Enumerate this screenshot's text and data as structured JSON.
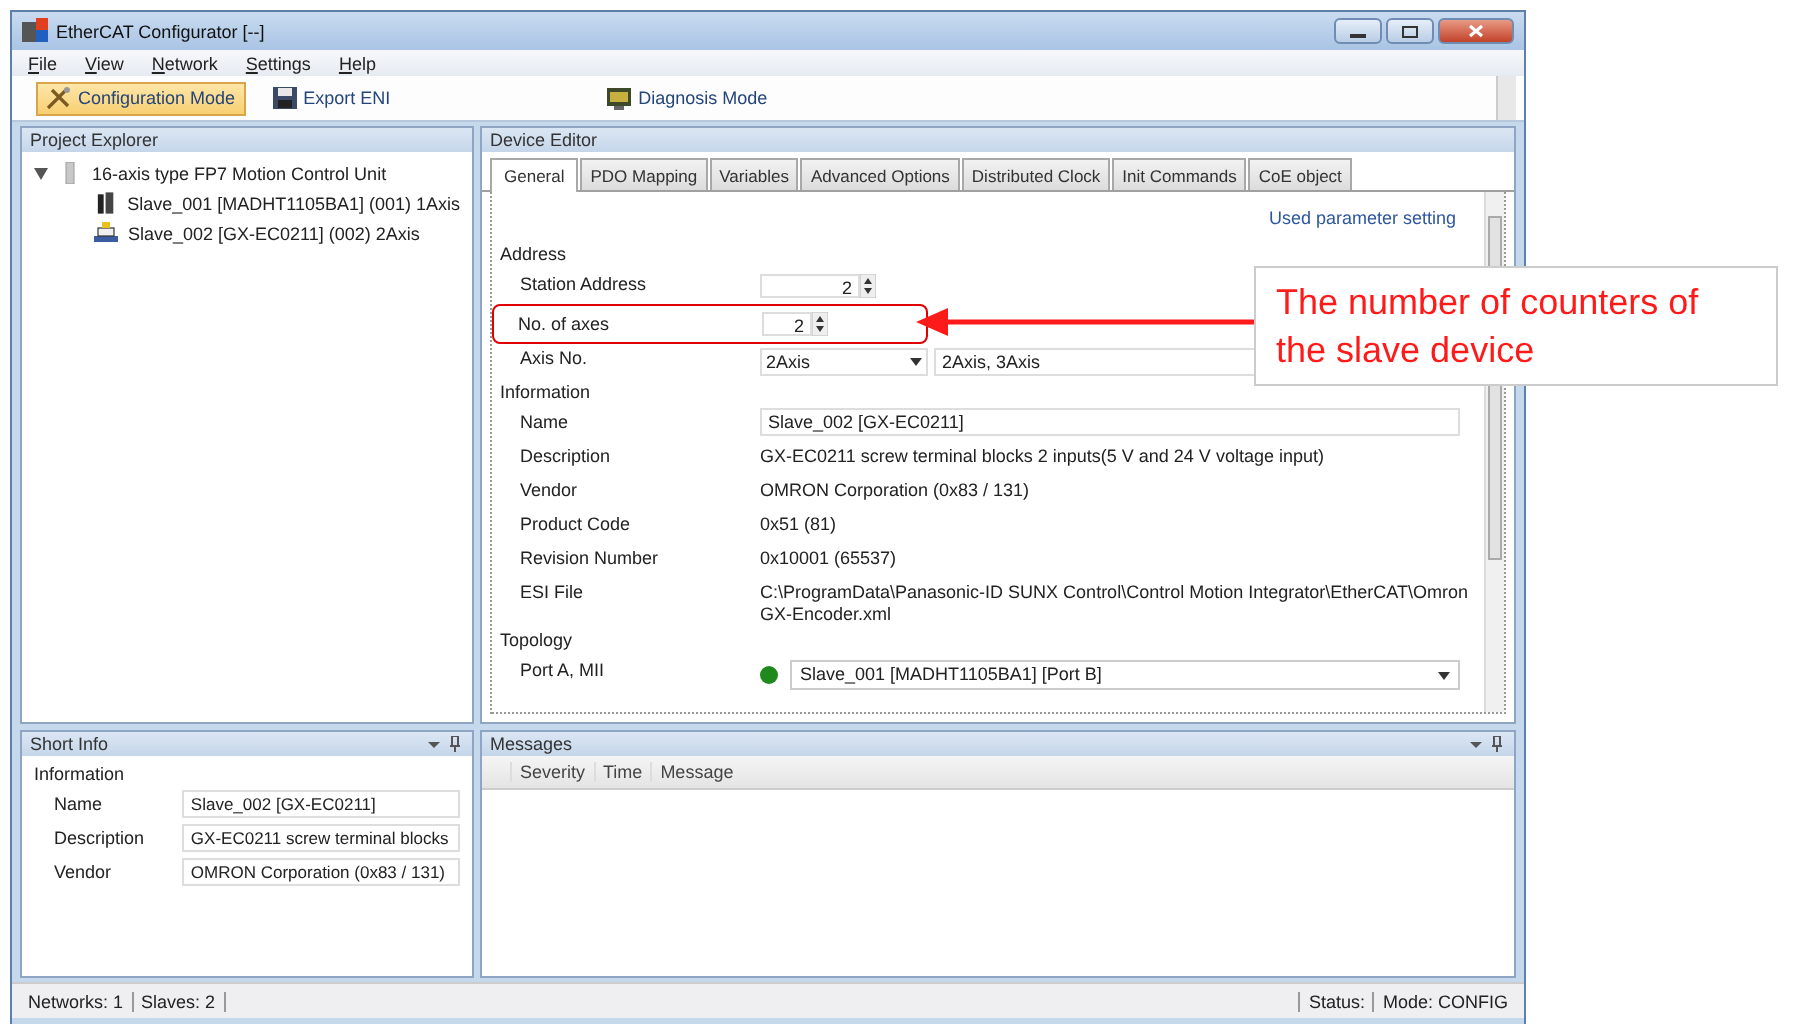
{
  "window": {
    "title": "EtherCAT Configurator [--]"
  },
  "menu": [
    "File",
    "View",
    "Network",
    "Settings",
    "Help"
  ],
  "toolbar": [
    {
      "label": "Configuration Mode",
      "kind": "tools",
      "selected": true
    },
    {
      "label": "Export ENI",
      "kind": "disk",
      "selected": false
    },
    {
      "label": "Diagnosis Mode",
      "kind": "monitor",
      "selected": false
    }
  ],
  "project_explorer": {
    "title": "Project Explorer",
    "tree": [
      {
        "label": "16-axis type FP7 Motion Control Unit",
        "kind": "unit",
        "expanded": true,
        "children": [
          {
            "label": "Slave_001 [MADHT1105BA1] (001) 1Axis",
            "kind": "servo"
          },
          {
            "label": "Slave_002 [GX-EC0211] (002) 2Axis",
            "kind": "encoder"
          }
        ]
      }
    ]
  },
  "device_editor": {
    "title": "Device Editor",
    "tabs": [
      {
        "label": "General",
        "selected": true
      },
      {
        "label": "PDO Mapping",
        "selected": false
      },
      {
        "label": "Variables",
        "selected": false
      },
      {
        "label": "Advanced Options",
        "selected": false
      },
      {
        "label": "Distributed Clock",
        "selected": false
      },
      {
        "label": "Init Commands",
        "selected": false
      },
      {
        "label": "CoE object",
        "selected": false
      }
    ],
    "link": "Used parameter setting",
    "sections": [
      {
        "title": "Address",
        "rows": [
          {
            "label": "Station Address",
            "kind": "spinner",
            "value": "2",
            "highlighted": false
          },
          {
            "label": "No. of axes",
            "kind": "spinner",
            "value": "2",
            "highlighted": true
          },
          {
            "label": "Axis No.",
            "kind": "dropdown",
            "value": "2Axis",
            "extra": "2Axis, 3Axis"
          }
        ]
      },
      {
        "title": "Information",
        "rows": [
          {
            "label": "Name",
            "kind": "field",
            "value": "Slave_002 [GX-EC0211]"
          },
          {
            "label": "Description",
            "kind": "text",
            "value": "GX-EC0211 screw terminal blocks 2 inputs(5 V and 24 V voltage input)"
          },
          {
            "label": "Vendor",
            "kind": "text",
            "value": "OMRON Corporation (0x83 / 131)"
          },
          {
            "label": "Product Code",
            "kind": "text",
            "value": "0x51 (81)"
          },
          {
            "label": "Revision Number",
            "kind": "text",
            "value": "0x10001 (65537)"
          },
          {
            "label": "ESI File",
            "kind": "text",
            "value": "C:\\ProgramData\\Panasonic-ID SUNX Control\\Control Motion Integrator\\EtherCAT\\Omron GX-Encoder.xml"
          }
        ]
      },
      {
        "title": "Topology",
        "rows": [
          {
            "label": "Port A, MII",
            "kind": "port",
            "value": "Slave_001 [MADHT1105BA1] [Port B]",
            "color": "#1e8a1e"
          }
        ]
      }
    ]
  },
  "short_info": {
    "title": "Short Info",
    "section": "Information",
    "rows": [
      {
        "label": "Name",
        "value": "Slave_002 [GX-EC0211]"
      },
      {
        "label": "Description",
        "value": "GX-EC0211 screw terminal blocks"
      },
      {
        "label": "Vendor",
        "value": "OMRON Corporation (0x83 / 131)"
      }
    ]
  },
  "messages": {
    "title": "Messages",
    "columns": [
      "Severity",
      "Time",
      "Message"
    ]
  },
  "status_bar": {
    "left": [
      "Networks: 1",
      "Slaves: 2"
    ],
    "right": [
      "Status:",
      "Mode: CONFIG"
    ]
  },
  "annotation": {
    "text": "The number of counters of the slave device"
  }
}
